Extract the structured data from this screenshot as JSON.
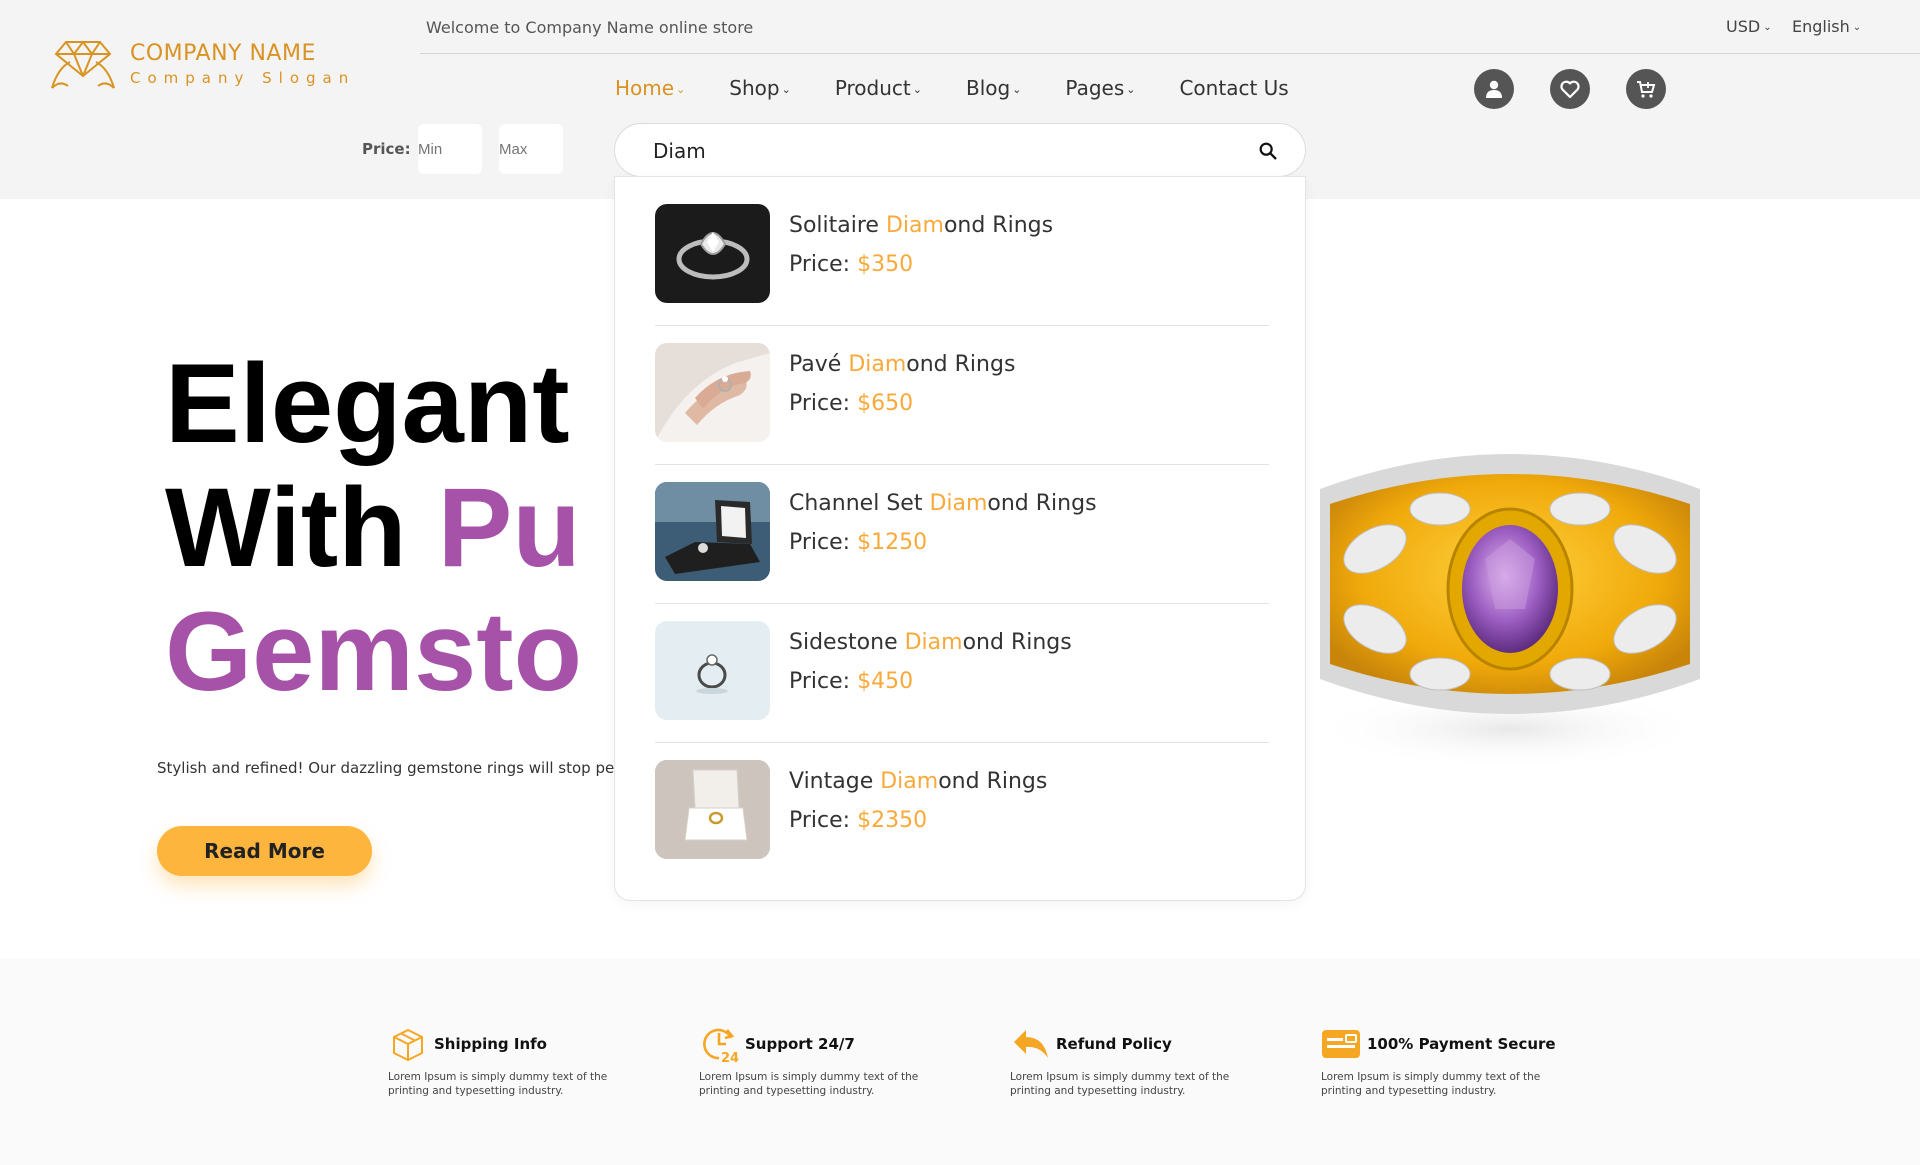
{
  "brand": {
    "name": "COMPANY NAME",
    "slogan": "Company Slogan",
    "accent_color": "#d99322"
  },
  "topbar": {
    "welcome": "Welcome to Company Name online store",
    "currency": "USD",
    "language": "English"
  },
  "nav": {
    "items": [
      {
        "label": "Home",
        "dropdown": true,
        "active": true
      },
      {
        "label": "Shop",
        "dropdown": true
      },
      {
        "label": "Product",
        "dropdown": true
      },
      {
        "label": "Blog",
        "dropdown": true
      },
      {
        "label": "Pages",
        "dropdown": true
      },
      {
        "label": "Contact Us",
        "dropdown": false
      }
    ]
  },
  "header_icons": [
    "user-icon",
    "heart-icon",
    "cart-icon"
  ],
  "price_filter": {
    "label": "Price:",
    "min_placeholder": "Min",
    "max_placeholder": "Max"
  },
  "search": {
    "value": "Diam",
    "icon": "search-icon"
  },
  "results": [
    {
      "prefix": "Solitaire ",
      "match": "Diam",
      "suffix": "ond Rings",
      "price_label": "Price:",
      "price": "$350"
    },
    {
      "prefix": "Pavé ",
      "match": "Diam",
      "suffix": "ond Rings",
      "price_label": "Price:",
      "price": "$650"
    },
    {
      "prefix": "Channel Set ",
      "match": "Diam",
      "suffix": "ond Rings",
      "price_label": "Price:",
      "price": "$1250"
    },
    {
      "prefix": "Sidestone ",
      "match": "Diam",
      "suffix": "ond Rings",
      "price_label": "Price:",
      "price": "$450"
    },
    {
      "prefix": "Vintage ",
      "match": "Diam",
      "suffix": "ond Rings",
      "price_label": "Price:",
      "price": "$2350"
    }
  ],
  "hero": {
    "line1": "Elegant",
    "line2_black": "With ",
    "line2_purple": "Pu",
    "line3_purple": "Gemsto",
    "description": "Stylish and refined! Our dazzling gemstone rings will stop people i",
    "button": "Read More",
    "highlight_color": "#a552a8"
  },
  "features": [
    {
      "icon": "box-icon",
      "title": "Shipping Info",
      "text": "Lorem Ipsum is simply dummy text of the printing and typesetting industry."
    },
    {
      "icon": "support-24-icon",
      "title": "Support 24/7",
      "text": "Lorem Ipsum is simply dummy text of the printing and typesetting industry."
    },
    {
      "icon": "return-arrow-icon",
      "title": "Refund Policy",
      "text": "Lorem Ipsum is simply dummy text of the printing and typesetting industry."
    },
    {
      "icon": "credit-card-icon",
      "title": "100% Payment Secure",
      "text": "Lorem Ipsum is simply dummy text of the printing and typesetting industry."
    }
  ]
}
